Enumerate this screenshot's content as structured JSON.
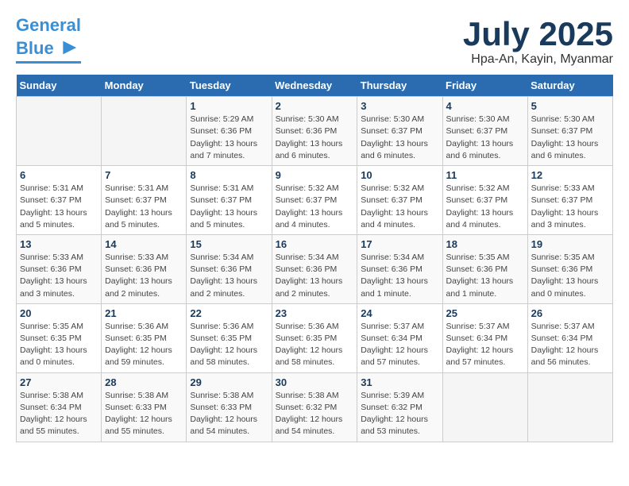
{
  "header": {
    "logo_general": "General",
    "logo_blue": "Blue",
    "month_title": "July 2025",
    "location": "Hpa-An, Kayin, Myanmar"
  },
  "weekdays": [
    "Sunday",
    "Monday",
    "Tuesday",
    "Wednesday",
    "Thursday",
    "Friday",
    "Saturday"
  ],
  "weeks": [
    [
      {
        "day": "",
        "info": ""
      },
      {
        "day": "",
        "info": ""
      },
      {
        "day": "1",
        "info": "Sunrise: 5:29 AM\nSunset: 6:36 PM\nDaylight: 13 hours and 7 minutes."
      },
      {
        "day": "2",
        "info": "Sunrise: 5:30 AM\nSunset: 6:36 PM\nDaylight: 13 hours and 6 minutes."
      },
      {
        "day": "3",
        "info": "Sunrise: 5:30 AM\nSunset: 6:37 PM\nDaylight: 13 hours and 6 minutes."
      },
      {
        "day": "4",
        "info": "Sunrise: 5:30 AM\nSunset: 6:37 PM\nDaylight: 13 hours and 6 minutes."
      },
      {
        "day": "5",
        "info": "Sunrise: 5:30 AM\nSunset: 6:37 PM\nDaylight: 13 hours and 6 minutes."
      }
    ],
    [
      {
        "day": "6",
        "info": "Sunrise: 5:31 AM\nSunset: 6:37 PM\nDaylight: 13 hours and 5 minutes."
      },
      {
        "day": "7",
        "info": "Sunrise: 5:31 AM\nSunset: 6:37 PM\nDaylight: 13 hours and 5 minutes."
      },
      {
        "day": "8",
        "info": "Sunrise: 5:31 AM\nSunset: 6:37 PM\nDaylight: 13 hours and 5 minutes."
      },
      {
        "day": "9",
        "info": "Sunrise: 5:32 AM\nSunset: 6:37 PM\nDaylight: 13 hours and 4 minutes."
      },
      {
        "day": "10",
        "info": "Sunrise: 5:32 AM\nSunset: 6:37 PM\nDaylight: 13 hours and 4 minutes."
      },
      {
        "day": "11",
        "info": "Sunrise: 5:32 AM\nSunset: 6:37 PM\nDaylight: 13 hours and 4 minutes."
      },
      {
        "day": "12",
        "info": "Sunrise: 5:33 AM\nSunset: 6:37 PM\nDaylight: 13 hours and 3 minutes."
      }
    ],
    [
      {
        "day": "13",
        "info": "Sunrise: 5:33 AM\nSunset: 6:36 PM\nDaylight: 13 hours and 3 minutes."
      },
      {
        "day": "14",
        "info": "Sunrise: 5:33 AM\nSunset: 6:36 PM\nDaylight: 13 hours and 2 minutes."
      },
      {
        "day": "15",
        "info": "Sunrise: 5:34 AM\nSunset: 6:36 PM\nDaylight: 13 hours and 2 minutes."
      },
      {
        "day": "16",
        "info": "Sunrise: 5:34 AM\nSunset: 6:36 PM\nDaylight: 13 hours and 2 minutes."
      },
      {
        "day": "17",
        "info": "Sunrise: 5:34 AM\nSunset: 6:36 PM\nDaylight: 13 hours and 1 minute."
      },
      {
        "day": "18",
        "info": "Sunrise: 5:35 AM\nSunset: 6:36 PM\nDaylight: 13 hours and 1 minute."
      },
      {
        "day": "19",
        "info": "Sunrise: 5:35 AM\nSunset: 6:36 PM\nDaylight: 13 hours and 0 minutes."
      }
    ],
    [
      {
        "day": "20",
        "info": "Sunrise: 5:35 AM\nSunset: 6:35 PM\nDaylight: 13 hours and 0 minutes."
      },
      {
        "day": "21",
        "info": "Sunrise: 5:36 AM\nSunset: 6:35 PM\nDaylight: 12 hours and 59 minutes."
      },
      {
        "day": "22",
        "info": "Sunrise: 5:36 AM\nSunset: 6:35 PM\nDaylight: 12 hours and 58 minutes."
      },
      {
        "day": "23",
        "info": "Sunrise: 5:36 AM\nSunset: 6:35 PM\nDaylight: 12 hours and 58 minutes."
      },
      {
        "day": "24",
        "info": "Sunrise: 5:37 AM\nSunset: 6:34 PM\nDaylight: 12 hours and 57 minutes."
      },
      {
        "day": "25",
        "info": "Sunrise: 5:37 AM\nSunset: 6:34 PM\nDaylight: 12 hours and 57 minutes."
      },
      {
        "day": "26",
        "info": "Sunrise: 5:37 AM\nSunset: 6:34 PM\nDaylight: 12 hours and 56 minutes."
      }
    ],
    [
      {
        "day": "27",
        "info": "Sunrise: 5:38 AM\nSunset: 6:34 PM\nDaylight: 12 hours and 55 minutes."
      },
      {
        "day": "28",
        "info": "Sunrise: 5:38 AM\nSunset: 6:33 PM\nDaylight: 12 hours and 55 minutes."
      },
      {
        "day": "29",
        "info": "Sunrise: 5:38 AM\nSunset: 6:33 PM\nDaylight: 12 hours and 54 minutes."
      },
      {
        "day": "30",
        "info": "Sunrise: 5:38 AM\nSunset: 6:32 PM\nDaylight: 12 hours and 54 minutes."
      },
      {
        "day": "31",
        "info": "Sunrise: 5:39 AM\nSunset: 6:32 PM\nDaylight: 12 hours and 53 minutes."
      },
      {
        "day": "",
        "info": ""
      },
      {
        "day": "",
        "info": ""
      }
    ]
  ]
}
